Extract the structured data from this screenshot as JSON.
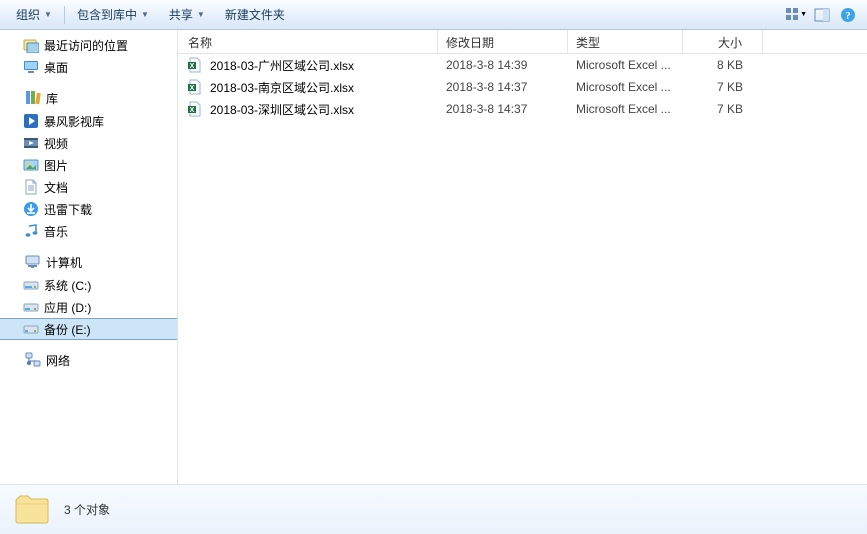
{
  "toolbar": {
    "organize": "组织",
    "include_in_library": "包含到库中",
    "share": "共享",
    "new_folder": "新建文件夹"
  },
  "nav": {
    "fav_group": {
      "recent": "最近访问的位置",
      "desktop": "桌面"
    },
    "libraries": {
      "header": "库",
      "storm": "暴风影视库",
      "video": "视频",
      "pictures": "图片",
      "documents": "文档",
      "xunlei": "迅雷下载",
      "music": "音乐"
    },
    "computer": {
      "header": "计算机",
      "sys": "系统 (C:)",
      "app": "应用 (D:)",
      "backup": "备份 (E:)"
    },
    "network": {
      "header": "网络"
    }
  },
  "columns": {
    "name": "名称",
    "date": "修改日期",
    "type": "类型",
    "size": "大小"
  },
  "files": [
    {
      "name": "2018-03-广州区域公司.xlsx",
      "date": "2018-3-8 14:39",
      "type": "Microsoft Excel ...",
      "size": "8 KB"
    },
    {
      "name": "2018-03-南京区域公司.xlsx",
      "date": "2018-3-8 14:37",
      "type": "Microsoft Excel ...",
      "size": "7 KB"
    },
    {
      "name": "2018-03-深圳区域公司.xlsx",
      "date": "2018-3-8 14:37",
      "type": "Microsoft Excel ...",
      "size": "7 KB"
    }
  ],
  "status": {
    "text": "3 个对象"
  }
}
